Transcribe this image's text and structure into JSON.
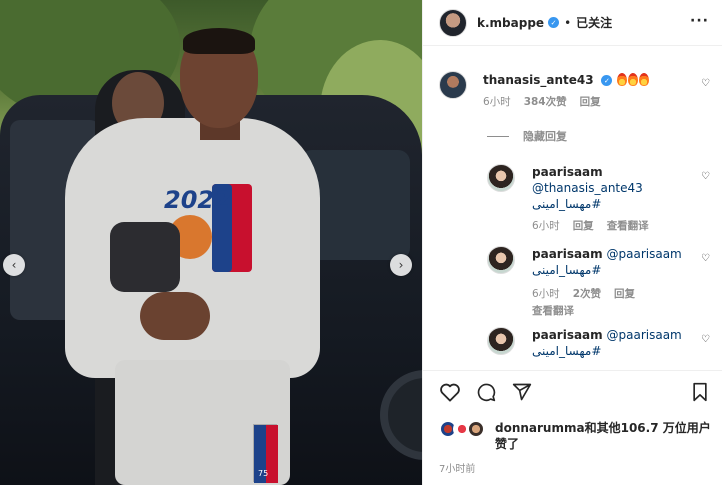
{
  "header": {
    "username": "k.mbappe",
    "dot": "•",
    "follow_status": "已关注",
    "more": "···"
  },
  "photo": {
    "sweatshirt_year": "2022",
    "jersey_number": "75",
    "prev": "‹",
    "next": "›"
  },
  "comments": [
    {
      "username": "thanasis_ante43",
      "verified": true,
      "time": "6小时",
      "likes": "384次赞",
      "reply": "回复"
    }
  ],
  "hide_replies": "隐藏回复",
  "replies": [
    {
      "username": "paarisaam",
      "mention": "@thanasis_ante43",
      "tag": "#مهسا_امینی",
      "time": "6小时",
      "reply": "回复",
      "translate": "查看翻译"
    },
    {
      "username": "paarisaam",
      "mention": "@paarisaam",
      "tag": "#مهسا_امینی",
      "time": "6小时",
      "likes": "2次赞",
      "reply": "回复",
      "translate": "查看翻译"
    },
    {
      "username": "paarisaam",
      "mention": "@paarisaam",
      "tag": "#مهسا_امینی"
    }
  ],
  "likes_summary": {
    "first_user": "donnarumma",
    "rest": "和其他106.7 万位用户赞了"
  },
  "post_time": "7小时前",
  "colors": {
    "link": "#00376b",
    "muted": "#8e8e8e",
    "verified": "#3897f0"
  },
  "icons": [
    "heart-icon",
    "comment-icon",
    "share-icon",
    "bookmark-icon",
    "more-icon",
    "verified-icon",
    "fire-emoji"
  ]
}
